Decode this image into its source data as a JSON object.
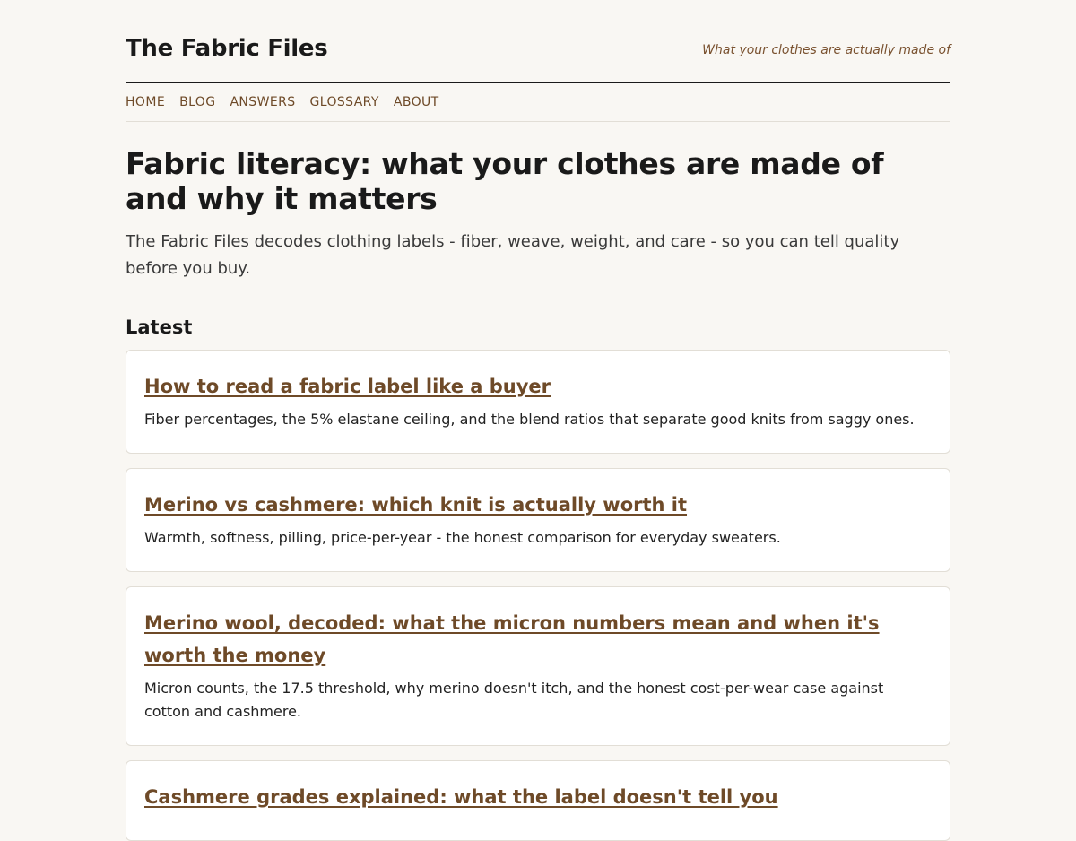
{
  "site": {
    "title": "The Fabric Files",
    "tagline": "What your clothes are actually made of"
  },
  "nav": {
    "items": [
      {
        "label": "HOME"
      },
      {
        "label": "BLOG"
      },
      {
        "label": "ANSWERS"
      },
      {
        "label": "GLOSSARY"
      },
      {
        "label": "ABOUT"
      }
    ]
  },
  "main": {
    "title": "Fabric literacy: what your clothes are made of and why it matters",
    "intro": "The Fabric Files decodes clothing labels - fiber, weave, weight, and care - so you can tell quality before you buy.",
    "section_title": "Latest",
    "posts": [
      {
        "title": "How to read a fabric label like a buyer",
        "summary": "Fiber percentages, the 5% elastane ceiling, and the blend ratios that separate good knits from saggy ones."
      },
      {
        "title": "Merino vs cashmere: which knit is actually worth it",
        "summary": "Warmth, softness, pilling, price-per-year - the honest comparison for everyday sweaters."
      },
      {
        "title": "Merino wool, decoded: what the micron numbers mean and when it's worth the money",
        "summary": "Micron counts, the 17.5 threshold, why merino doesn't itch, and the honest cost-per-wear case against cotton and cashmere."
      },
      {
        "title": "Cashmere grades explained: what the label doesn't tell you",
        "summary": ""
      }
    ]
  },
  "colors": {
    "background": "#f9f7f3",
    "accent": "#6e4a28",
    "tagline": "#7a5230",
    "card_border": "#e2ded6"
  }
}
